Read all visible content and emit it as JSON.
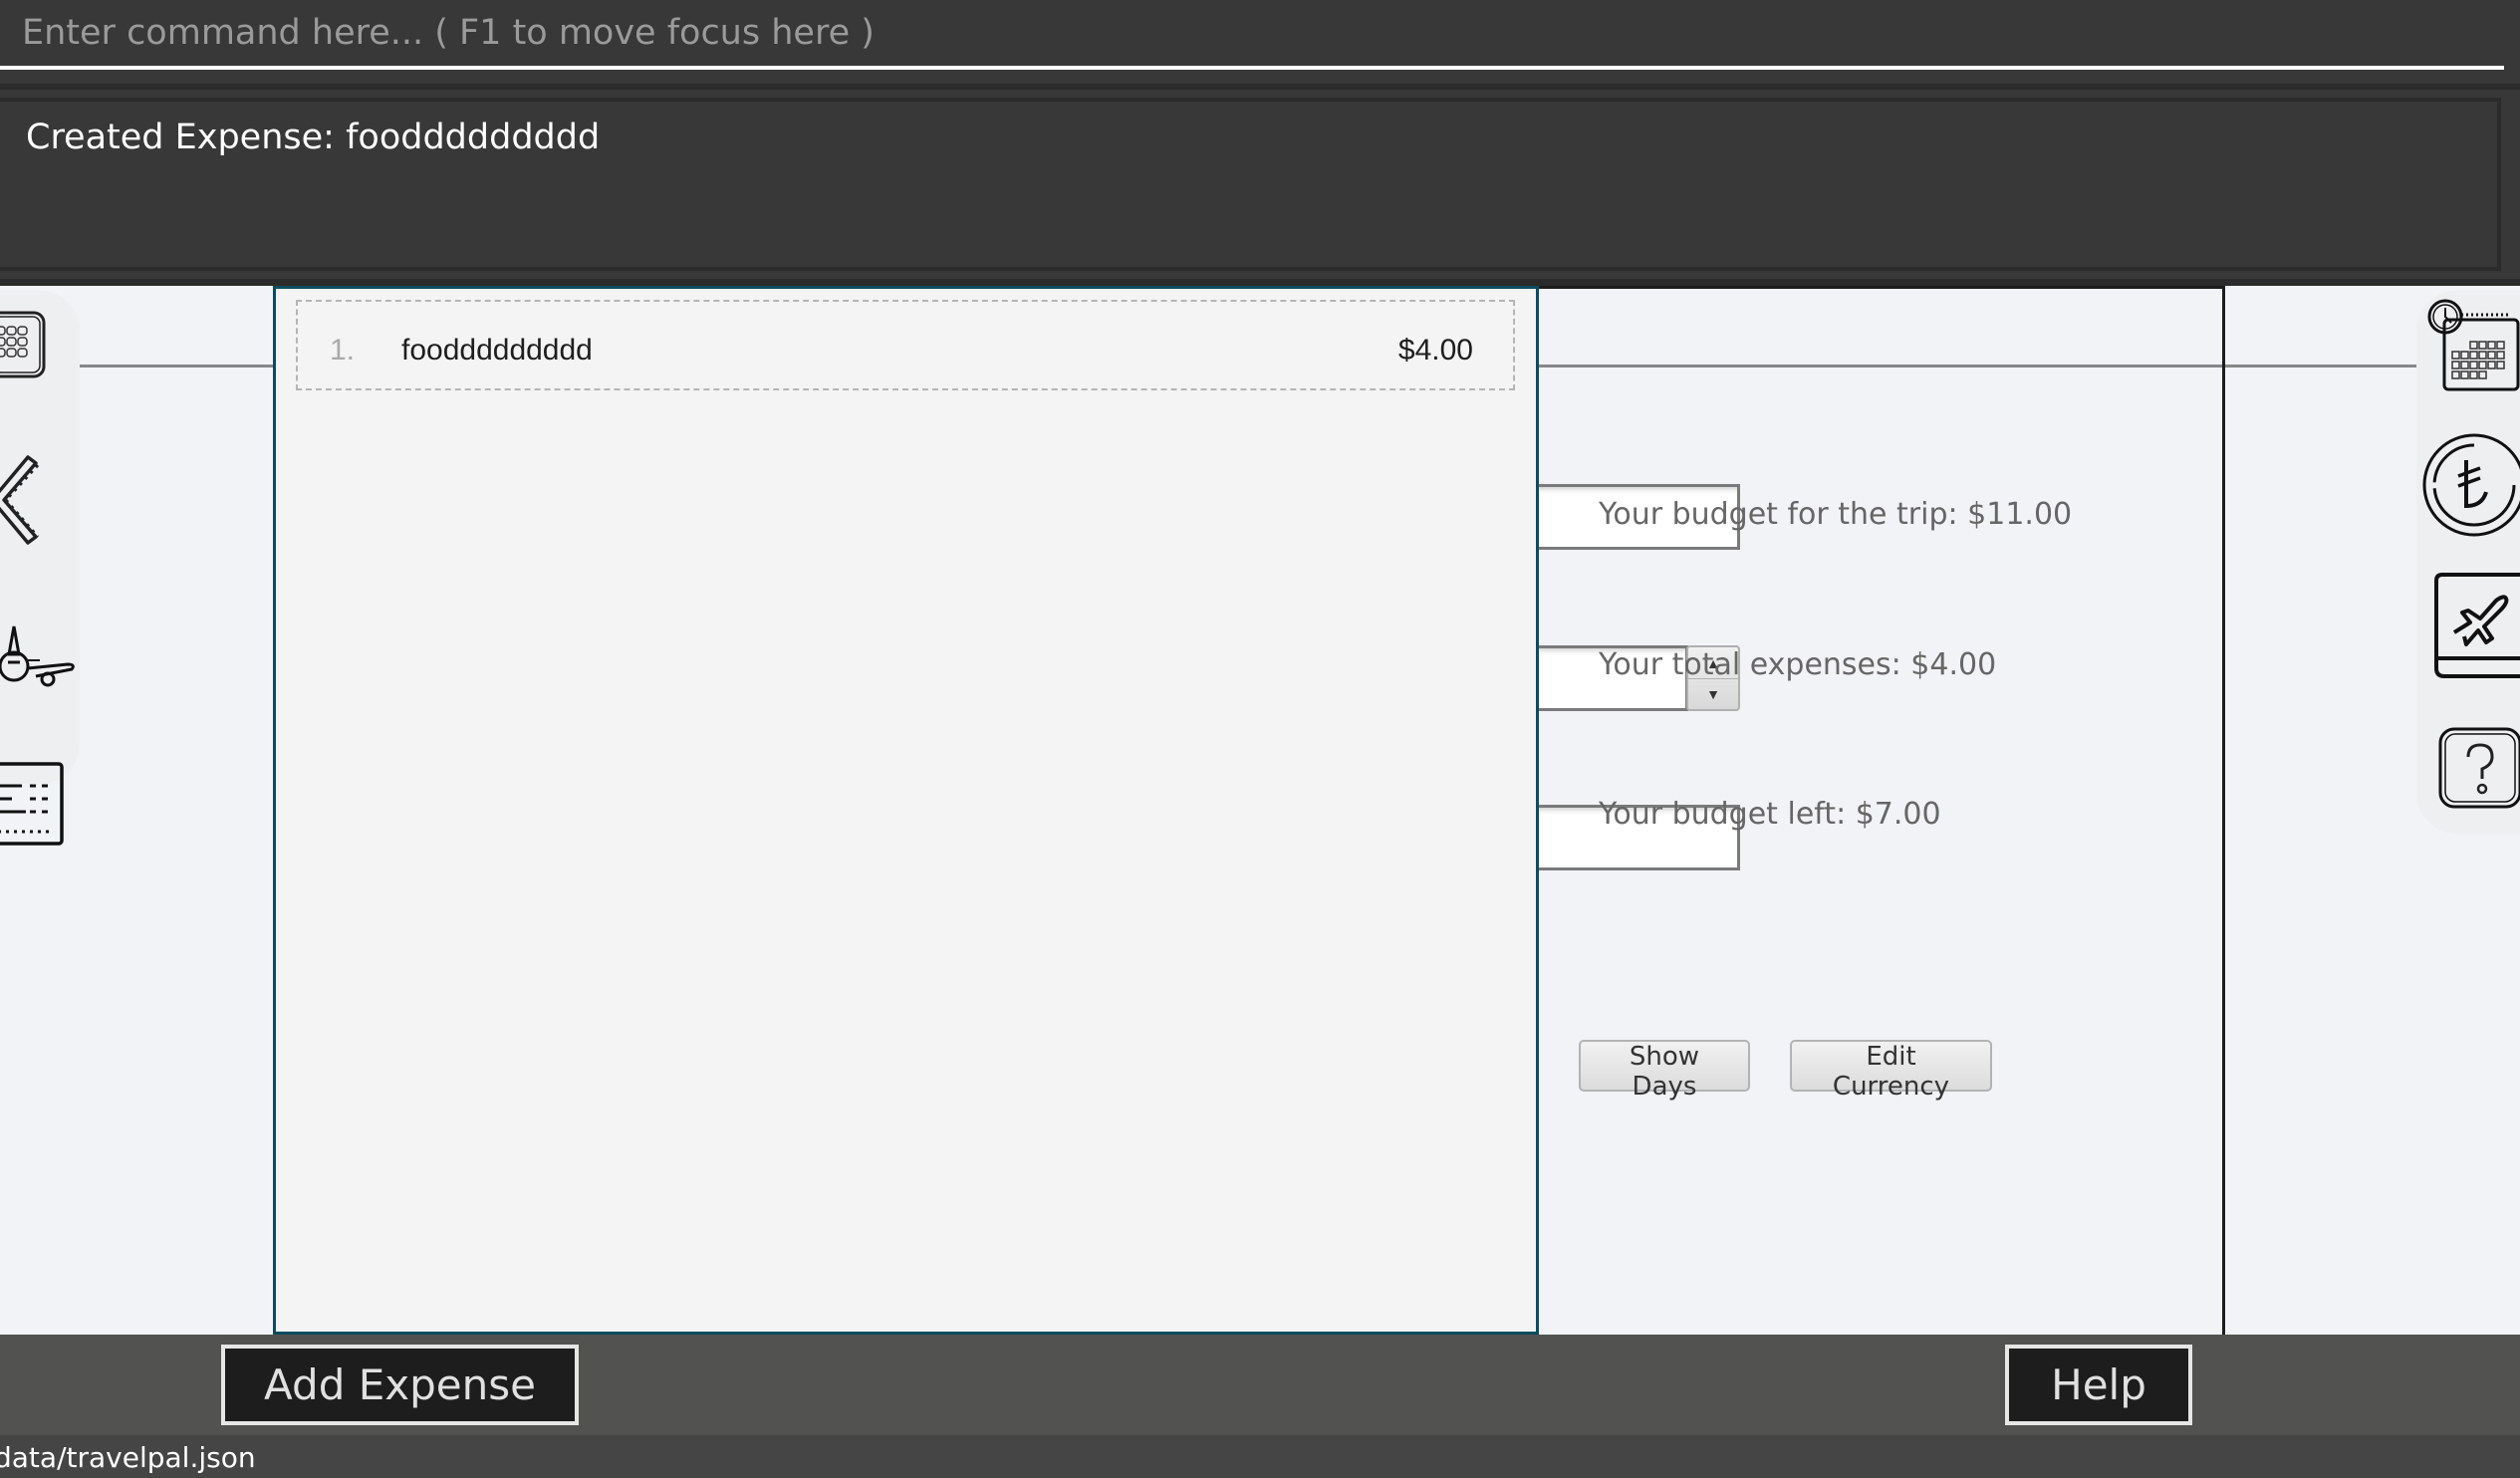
{
  "command_box": {
    "value": "",
    "placeholder": "Enter command here... ( F1 to move focus here )"
  },
  "result_display": {
    "text": "Created Expense: fooddddddddd"
  },
  "left_sidebar": {
    "icons": [
      "calendar-keypad-icon",
      "ruler-set-square-icon",
      "airplane-icon",
      "boarding-ticket-icon"
    ]
  },
  "right_sidebar": {
    "icons": [
      "schedule-calendar-icon",
      "currency-coin-icon",
      "travel-book-icon",
      "help-question-icon"
    ]
  },
  "expense_list": {
    "items": [
      {
        "index": "1.",
        "name": "fooddddddddd",
        "amount": "$4.00"
      }
    ]
  },
  "budget_panel": {
    "budget_label": "Your budget for the trip: $11.00",
    "total_expenses_label": "Your total expenses: $4.00",
    "budget_left_label": "Your budget left: $7.00",
    "show_days_label": "Show Days",
    "edit_currency_label": "Edit Currency"
  },
  "bottom_bar": {
    "add_expense_label": "Add Expense",
    "help_label": "Help"
  },
  "status_bar": {
    "save_location": "data/travelpal.json"
  },
  "colors": {
    "dark_background": "#383838",
    "panel_background": "#f2f3f6",
    "list_border": "#0c4c5e",
    "button_bar": "#525250",
    "status_bar": "#454545"
  }
}
